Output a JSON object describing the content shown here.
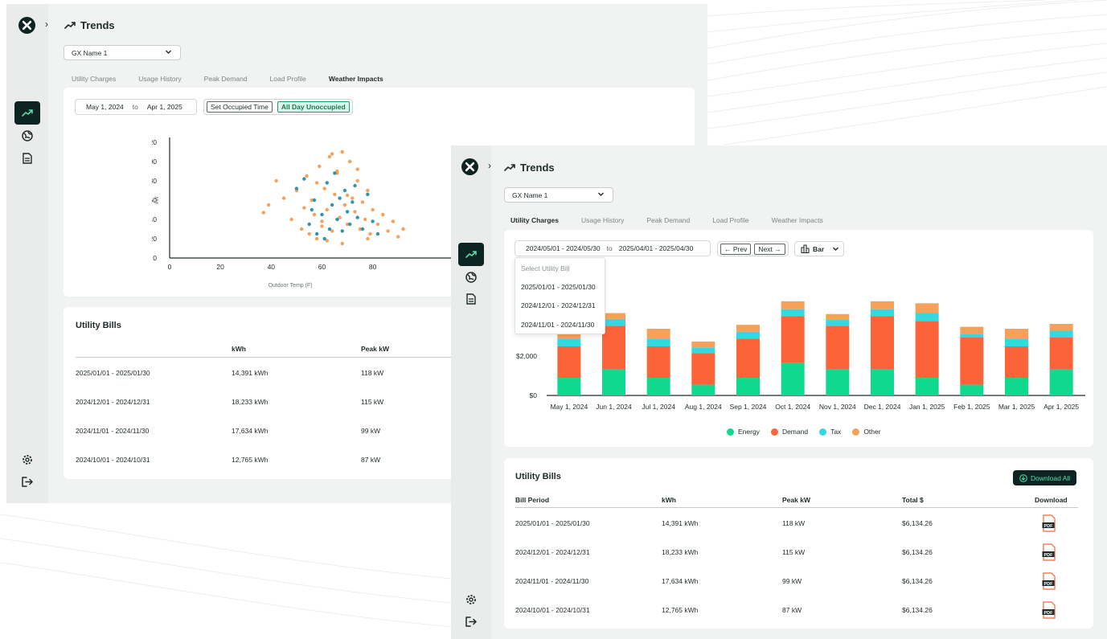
{
  "colors": {
    "dark": "#0e2422",
    "energy": "#0fd98f",
    "demand": "#fb6338",
    "tax": "#33d9e0",
    "other": "#f7a05a",
    "scatter_orange": "#f7a05a",
    "scatter_blue": "#2f95ad"
  },
  "window1": {
    "title": "Trends",
    "gx_select": "GX Name 1",
    "tabs": [
      "Utility Charges",
      "Usage History",
      "Peak Demand",
      "Load Profile",
      "Weather Impacts"
    ],
    "active_tab": "Weather Impacts",
    "date_from": "May 1, 2024",
    "date_to_sep": "to",
    "date_to": "Apr 1, 2025",
    "set_occupied_btn": "Set Occupied Time",
    "all_day_btn": "All Day Unoccupied",
    "bills": {
      "title": "Utility Bills",
      "headers": [
        "kWh",
        "Peak kW"
      ],
      "rows": [
        {
          "period": "2025/01/01 - 2025/01/30",
          "kwh": "14,391 kWh",
          "peak": "118 kW"
        },
        {
          "period": "2024/12/01 - 2024/12/31",
          "kwh": "18,233 kWh",
          "peak": "115 kW"
        },
        {
          "period": "2024/11/01 - 2024/11/30",
          "kwh": "17,634 kWh",
          "peak": "99 kW"
        },
        {
          "period": "2024/10/01 - 2024/10/31",
          "kwh": "12,765 kWh",
          "peak": "87 kW"
        }
      ]
    }
  },
  "window2": {
    "title": "Trends",
    "gx_select": "GX Name 1",
    "tabs": [
      "Utility Charges",
      "Usage History",
      "Peak Demand",
      "Load Profile",
      "Weather Impacts"
    ],
    "active_tab": "Utility Charges",
    "date_from": "2024/05/01 - 2024/05/30",
    "date_to_sep": "to",
    "date_to": "2025/04/01 - 2025/04/30",
    "prev_btn": "Prev",
    "next_btn": "Next",
    "chart_type_select": "Bar",
    "dropdown": {
      "placeholder": "Select Utility Bill",
      "options": [
        "2025/01/01 - 2025/01/30",
        "2024/12/01 - 2024/12/31",
        "2024/11/01 - 2024/11/30"
      ]
    },
    "bills": {
      "title": "Utility Bills",
      "download_all": "Download All",
      "headers": [
        "Bill Period",
        "kWh",
        "Peak kW",
        "Total $",
        "Download"
      ],
      "pdf_label": "PDF",
      "rows": [
        {
          "period": "2025/01/01 - 2025/01/30",
          "kwh": "14,391 kWh",
          "peak": "118 kW",
          "total": "$6,134.26"
        },
        {
          "period": "2024/12/01 - 2024/12/31",
          "kwh": "18,233 kWh",
          "peak": "115 kW",
          "total": "$6,134.26"
        },
        {
          "period": "2024/11/01 - 2024/11/30",
          "kwh": "17,634 kWh",
          "peak": "99 kW",
          "total": "$6,134.26"
        },
        {
          "period": "2024/10/01 - 2024/10/31",
          "kwh": "12,765 kWh",
          "peak": "87 kW",
          "total": "$6,134.26"
        }
      ]
    }
  },
  "chart_data": [
    {
      "type": "scatter",
      "xlabel": "Outdoor Temp (F)",
      "ylabel": "kW",
      "xlim": [
        0,
        95
      ],
      "ylim": [
        0,
        120
      ],
      "x_ticks": [
        0,
        20,
        40,
        60,
        80
      ],
      "y_ticks": [
        0,
        20,
        40,
        60,
        80,
        100,
        120
      ],
      "grid": false,
      "series": [
        {
          "color": "orange",
          "x": [
            37,
            39,
            42,
            45,
            48,
            50,
            52,
            54,
            55,
            56,
            57,
            58,
            59,
            60,
            61,
            62,
            63,
            64,
            65,
            66,
            67,
            68,
            69,
            70,
            71,
            72,
            73,
            74,
            75,
            76,
            77,
            78,
            79,
            80,
            82,
            84,
            86,
            88,
            90,
            92,
            53,
            58,
            62,
            66,
            70,
            74,
            78,
            60,
            64,
            68
          ],
          "y": [
            47,
            55,
            80,
            62,
            40,
            70,
            30,
            85,
            25,
            60,
            45,
            20,
            95,
            38,
            72,
            50,
            105,
            28,
            66,
            90,
            42,
            110,
            55,
            35,
            100,
            62,
            48,
            80,
            30,
            58,
            40,
            70,
            25,
            50,
            35,
            45,
            28,
            38,
            22,
            30,
            52,
            78,
            18,
            88,
            65,
            92,
            20,
            33,
            108,
            15
          ]
        },
        {
          "color": "blue",
          "x": [
            50,
            53,
            55,
            57,
            58,
            60,
            62,
            63,
            64,
            65,
            66,
            67,
            68,
            69,
            70,
            71,
            72,
            74,
            76,
            78,
            80,
            82,
            56,
            61,
            73
          ],
          "y": [
            72,
            82,
            35,
            60,
            25,
            45,
            78,
            30,
            55,
            88,
            40,
            62,
            28,
            70,
            48,
            35,
            58,
            42,
            30,
            66,
            38,
            25,
            50,
            20,
            75
          ]
        }
      ]
    },
    {
      "type": "bar",
      "stacked": true,
      "categories": [
        "May 1, 2024",
        "Jun 1, 2024",
        "Jul 1, 2024",
        "Aug 1, 2024",
        "Sep 1, 2024",
        "Oct 1, 2024",
        "Nov 1, 2024",
        "Dec 1, 2024",
        "Jan 1, 2025",
        "Feb 1, 2025",
        "Mar 1, 2025",
        "Apr 1, 2025"
      ],
      "y_ticks_labeled": [
        "$0",
        "$2,000"
      ],
      "ylim": [
        0,
        5000
      ],
      "legend": "bottom",
      "series": [
        {
          "name": "Energy",
          "values": [
            900,
            1350,
            900,
            550,
            900,
            1650,
            1350,
            1350,
            900,
            550,
            900,
            1350
          ]
        },
        {
          "name": "Demand",
          "values": [
            1600,
            2200,
            1600,
            1600,
            2000,
            2400,
            2200,
            2700,
            2900,
            2400,
            1600,
            1600
          ]
        },
        {
          "name": "Tax",
          "values": [
            400,
            350,
            400,
            300,
            350,
            350,
            300,
            350,
            400,
            200,
            400,
            350
          ]
        },
        {
          "name": "Other",
          "values": [
            350,
            300,
            500,
            300,
            350,
            400,
            300,
            400,
            500,
            350,
            500,
            350
          ]
        }
      ]
    }
  ]
}
